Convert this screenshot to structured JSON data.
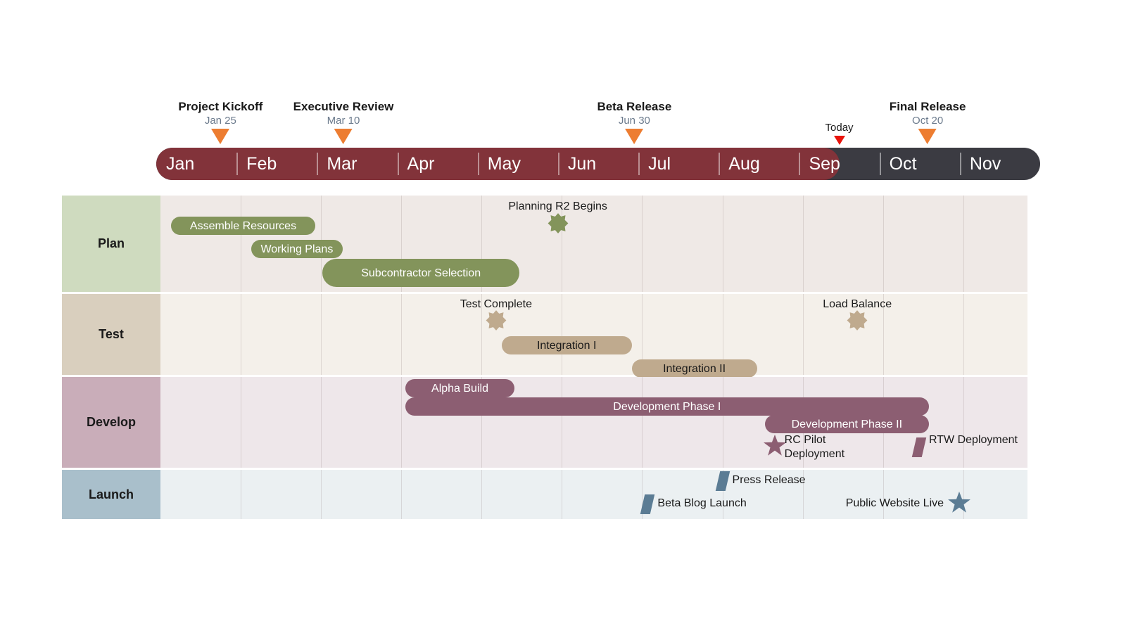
{
  "chart_data": {
    "type": "bar",
    "subtype": "gantt-timeline",
    "title": "",
    "axis": {
      "months": [
        "Jan",
        "Feb",
        "Mar",
        "Apr",
        "May",
        "Jun",
        "Jul",
        "Aug",
        "Sep",
        "Oct",
        "Nov"
      ],
      "past_color": "#82333A",
      "future_color": "#3B3B42",
      "today_label": "Today",
      "today_month_fraction": 8.5
    },
    "milestones": [
      {
        "name": "Project Kickoff",
        "date": "Jan 25",
        "month_pos": 0.8,
        "color": "#ED7D31"
      },
      {
        "name": "Executive Review",
        "date": "Mar 10",
        "month_pos": 2.33,
        "color": "#ED7D31"
      },
      {
        "name": "Beta Release",
        "date": "Jun 30",
        "month_pos": 5.95,
        "color": "#ED7D31"
      },
      {
        "name": "Final Release",
        "date": "Oct 20",
        "month_pos": 9.6,
        "color": "#ED7D31"
      }
    ],
    "lanes": [
      {
        "name": "Plan",
        "label_color": "#CFDBBF",
        "row_color": "#EFE9E6",
        "bar_color": "#83945B",
        "bar_text_color": "#ffffff",
        "tasks": [
          {
            "label": "Assemble Resources",
            "start": 0.13,
            "end": 1.93
          },
          {
            "label": "Working Plans",
            "start": 1.13,
            "end": 2.27
          },
          {
            "label": "Subcontractor\nSelection",
            "start": 2.02,
            "end": 4.47
          }
        ],
        "markers": [
          {
            "label": "Planning R2 Begins",
            "shape": "burst",
            "pos": 4.95,
            "label_align": "center"
          }
        ]
      },
      {
        "name": "Test",
        "label_color": "#D9CFBE",
        "row_color": "#F4F0EA",
        "bar_color": "#BFAA8E",
        "bar_text_color": "#1a1a1a",
        "tasks": [
          {
            "label": "Integration I",
            "start": 4.25,
            "end": 5.87
          },
          {
            "label": "Integration II",
            "start": 5.87,
            "end": 7.43
          }
        ],
        "markers": [
          {
            "label": "Test Complete",
            "shape": "burst",
            "pos": 4.18,
            "label_align": "center"
          },
          {
            "label": "Load Balance",
            "shape": "burst",
            "pos": 8.68,
            "label_align": "center"
          }
        ]
      },
      {
        "name": "Develop",
        "label_color": "#C9ADB9",
        "row_color": "#EEE7EA",
        "bar_color": "#8C5E72",
        "bar_text_color": "#ffffff",
        "tasks": [
          {
            "label": "Alpha Build",
            "start": 3.05,
            "end": 4.41
          },
          {
            "label": "Development Phase I",
            "start": 3.05,
            "end": 9.57
          },
          {
            "label": "Development Phase II",
            "start": 7.53,
            "end": 9.57
          }
        ],
        "markers": [
          {
            "label": "RC Pilot\nDeployment",
            "shape": "star",
            "pos": 7.65,
            "label_align": "right-of"
          },
          {
            "label": "RTW Deployment",
            "shape": "parallelogram",
            "pos": 9.45,
            "label_align": "right-of"
          }
        ]
      },
      {
        "name": "Launch",
        "label_color": "#A9BFCB",
        "row_color": "#EBF0F2",
        "bar_color": "#5B7C94",
        "bar_text_color": "#ffffff",
        "tasks": [],
        "markers": [
          {
            "label": "Press Release",
            "shape": "parallelogram",
            "pos": 7.0,
            "label_align": "right-of",
            "sub_row": 0
          },
          {
            "label": "Beta Blog Launch",
            "shape": "parallelogram",
            "pos": 6.07,
            "label_align": "right-of",
            "sub_row": 1
          },
          {
            "label": "Public Website Live",
            "shape": "star",
            "pos": 9.95,
            "label_align": "left-of",
            "sub_row": 1
          }
        ]
      }
    ]
  }
}
